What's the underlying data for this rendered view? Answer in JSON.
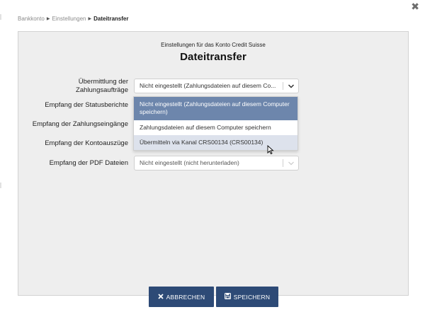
{
  "dialog": {
    "close_glyph": "✖"
  },
  "breadcrumb": {
    "items": [
      "Bankkonto",
      "Einstellungen"
    ],
    "current": "Dateitransfer"
  },
  "header": {
    "subtitle": "Einstellungen für das Konto Credit Suisse",
    "title": "Dateitransfer"
  },
  "fields": [
    {
      "label": "Übermittlung der Zahlungsaufträge",
      "value": "Nicht eingestellt (Zahlungsdateien auf diesem Co..."
    },
    {
      "label": "Empfang der Statusberichte",
      "value": ""
    },
    {
      "label": "Empfang der Zahlungseingänge",
      "value": ""
    },
    {
      "label": "Empfang der Kontoauszüge",
      "value": ""
    },
    {
      "label": "Empfang der PDF Dateien",
      "value": "Nicht eingestellt (nicht herunterladen)"
    }
  ],
  "dropdown": {
    "options": [
      "Nicht eingestellt (Zahlungsdateien auf diesem Computer speichern)",
      "Zahlungsdateien auf diesem Computer speichern",
      "Übermitteln via Kanal CRS00134 (CRS00134)"
    ],
    "selected_index": 0,
    "hover_index": 2
  },
  "buttons": {
    "cancel_label": "ABBRECHEN",
    "save_label": "SPEICHERN"
  },
  "colors": {
    "primary_button": "#2d4a76",
    "selected_option": "#6d86ac",
    "hover_option": "#dde2ec",
    "panel_bg": "#eeeeee"
  }
}
